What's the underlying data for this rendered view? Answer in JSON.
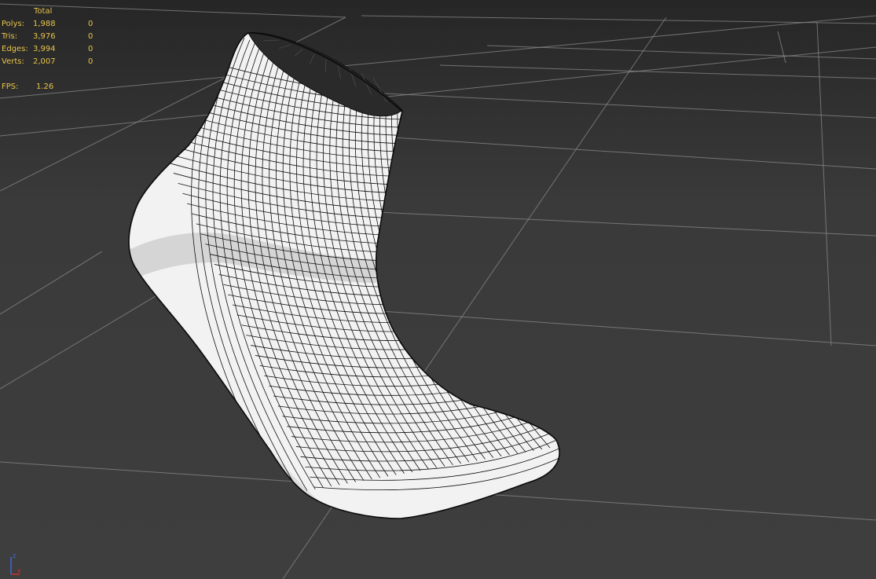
{
  "stats": {
    "header": "Total",
    "rows": [
      {
        "label": "Polys:",
        "total": "1,988",
        "selected": "0"
      },
      {
        "label": "Tris:",
        "total": "3,976",
        "selected": "0"
      },
      {
        "label": "Edges:",
        "total": "3,994",
        "selected": "0"
      },
      {
        "label": "Verts:",
        "total": "2,007",
        "selected": "0"
      }
    ],
    "fps_label": "FPS:",
    "fps_value": "1.26"
  },
  "axis_tripod": {
    "x_label": "x",
    "z_label": "z"
  },
  "colors": {
    "stats_text": "#e8c44a",
    "grid_line": "#8a8a8a",
    "mesh_fill": "#f2f2f2",
    "wire": "#111111",
    "axis_x": "#d23030",
    "axis_z": "#3a6ce0"
  }
}
